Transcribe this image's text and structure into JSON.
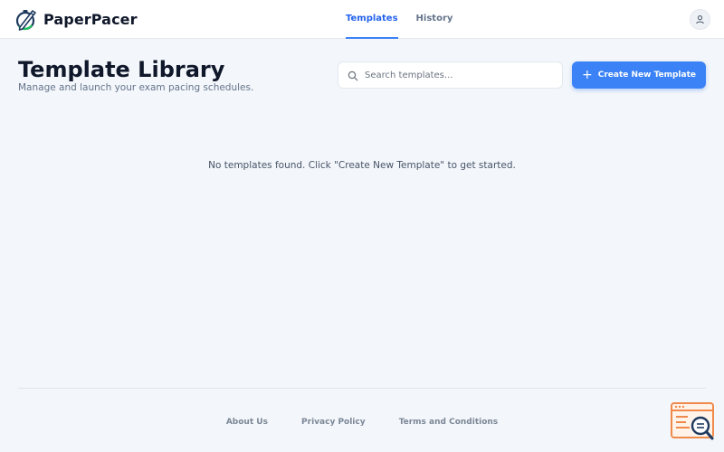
{
  "app": {
    "name": "PaperPacer"
  },
  "nav": {
    "tabs": [
      {
        "label": "Templates",
        "active": true
      },
      {
        "label": "History",
        "active": false
      }
    ]
  },
  "user": {
    "icon": "user-icon"
  },
  "header": {
    "title": "Template Library",
    "subtitle": "Manage and launch your exam pacing schedules."
  },
  "search": {
    "placeholder": "Search templates...",
    "value": ""
  },
  "actions": {
    "create_label": "Create New Template"
  },
  "empty_state": {
    "message": "No templates found. Click \"Create New Template\" to get started."
  },
  "footer": {
    "links": [
      "About Us",
      "Privacy Policy",
      "Terms and Conditions"
    ]
  },
  "colors": {
    "accent": "#3b82f6",
    "background": "#f3f6fa",
    "widget": "#f08a4b"
  }
}
